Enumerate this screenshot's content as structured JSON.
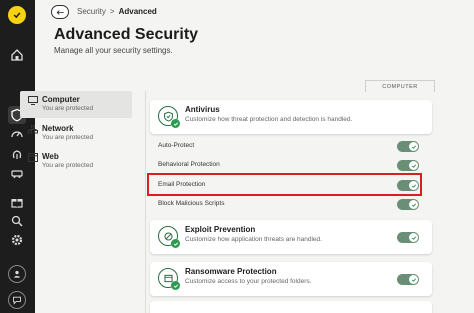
{
  "rail": {
    "icons": [
      "app-logo",
      "home-icon",
      "shield-icon",
      "speedometer-icon",
      "fingerprint-icon",
      "car-icon",
      "gift-icon",
      "search-icon",
      "settings-icon",
      "account-icon",
      "chat-icon"
    ]
  },
  "header": {
    "breadcrumb_parent": "Security",
    "breadcrumb_separator": ">",
    "breadcrumb_current": "Advanced",
    "title": "Advanced Security",
    "subtitle": "Manage all your security settings."
  },
  "categories": [
    {
      "name": "Computer",
      "status": "You are protected",
      "active": true
    },
    {
      "name": "Network",
      "status": "You are protected",
      "active": false
    },
    {
      "name": "Web",
      "status": "You are protected",
      "active": false
    }
  ],
  "panel_tab": "COMPUTER",
  "antivirus": {
    "title": "Antivirus",
    "description": "Customize how threat protection and detection is handled."
  },
  "settings": [
    {
      "label": "Auto-Protect",
      "enabled": true
    },
    {
      "label": "Behavioral Protection",
      "enabled": true
    },
    {
      "label": "Email Protection",
      "enabled": true
    },
    {
      "label": "Block Malicious Scripts",
      "enabled": true
    }
  ],
  "exploit": {
    "title": "Exploit Prevention",
    "description": "Customize how application threats are handled.",
    "enabled": true
  },
  "ransomware": {
    "title": "Ransomware Protection",
    "description": "Customize access to your protected folders.",
    "enabled": true
  },
  "colors": {
    "rail": "#1d1d1d",
    "logo": "#f5d30f",
    "toggle_on": "#6b8f76",
    "check": "#2e9a52",
    "highlight": "#d81f26"
  }
}
